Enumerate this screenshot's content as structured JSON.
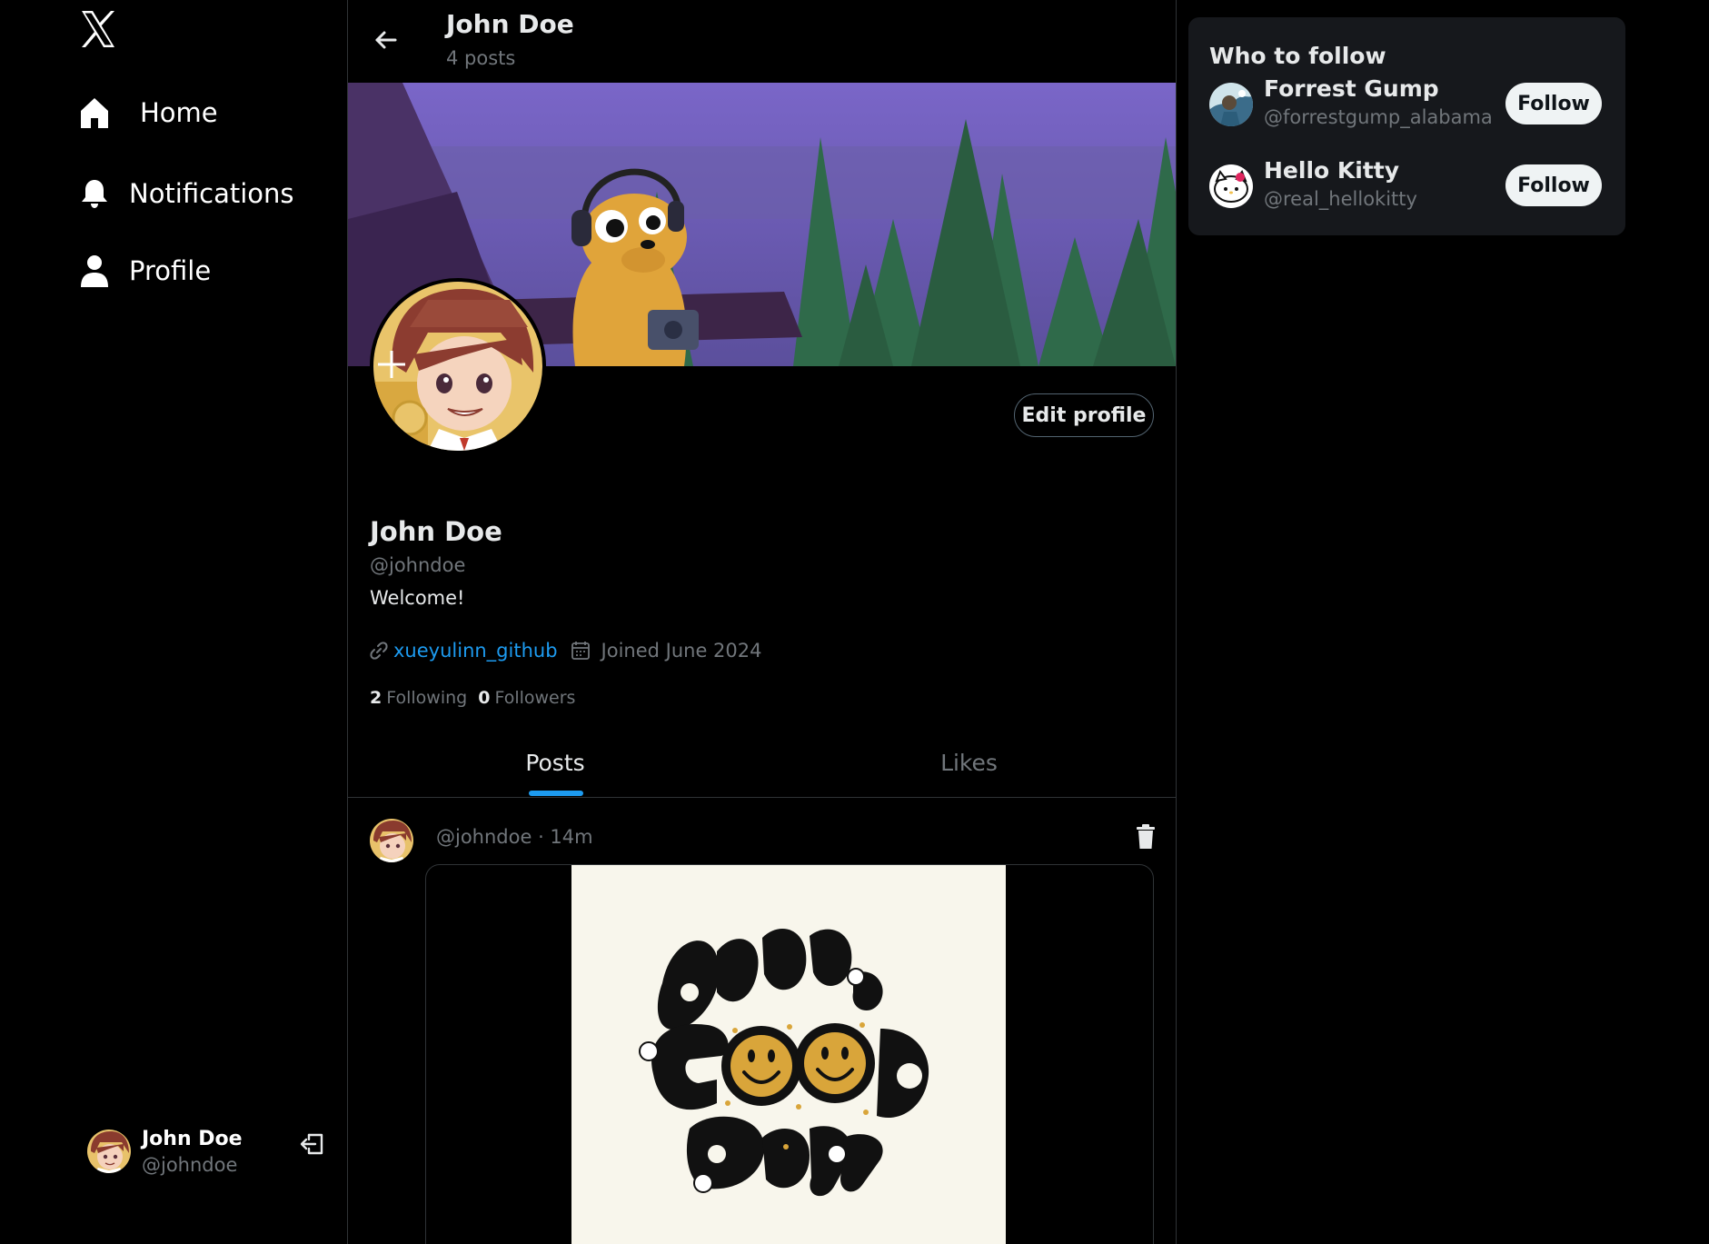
{
  "nav": {
    "logo_icon": "x-logo-icon",
    "items": [
      {
        "label": "Home",
        "icon": "home-icon"
      },
      {
        "label": "Notifications",
        "icon": "bell-icon"
      },
      {
        "label": "Profile",
        "icon": "user-icon"
      }
    ]
  },
  "account": {
    "name": "John Doe",
    "handle": "@johndoe"
  },
  "header": {
    "title": "John Doe",
    "subtitle": "4 posts"
  },
  "profile": {
    "edit_label": "Edit profile",
    "name": "John Doe",
    "handle": "@johndoe",
    "bio": "Welcome!",
    "link": "xueyulinn_github",
    "joined": "Joined June 2024",
    "following_count": "2",
    "following_label": "Following",
    "followers_count": "0",
    "followers_label": "Followers"
  },
  "tabs": [
    {
      "label": "Posts",
      "active": true
    },
    {
      "label": "Likes",
      "active": false
    }
  ],
  "post": {
    "meta": "@johndoe · 14m",
    "image_text": "have a GOOD DAY"
  },
  "who_to_follow": {
    "title": "Who to follow",
    "users": [
      {
        "name": "Forrest Gump",
        "handle": "@forrestgump_alabama",
        "button": "Follow"
      },
      {
        "name": "Hello Kitty",
        "handle": "@real_hellokitty",
        "button": "Follow"
      }
    ]
  },
  "colors": {
    "background": "#000000",
    "accent": "#1d9bf0",
    "muted_text": "#71767b",
    "panel": "#16181c",
    "border": "#2f3336"
  }
}
